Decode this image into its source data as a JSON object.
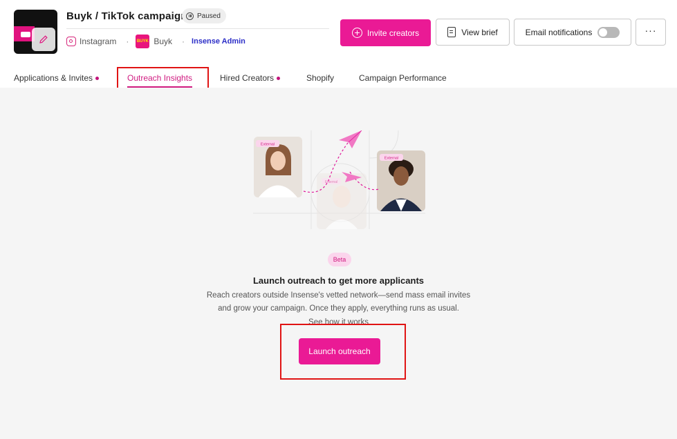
{
  "header": {
    "title": "Buyk / TikTok campaign",
    "status": "Paused",
    "platform": "Instagram",
    "brand": "Buyk",
    "brand_logo_text": "BUYK",
    "admin_label": "Insense Admin"
  },
  "actions": {
    "invite": "Invite creators",
    "brief": "View brief",
    "email": "Email notifications",
    "more": "···"
  },
  "tabs": [
    {
      "label": "Applications & Invites",
      "dot": true
    },
    {
      "label": "Outreach Insights",
      "active": true
    },
    {
      "label": "Hired Creators",
      "dot": true
    },
    {
      "label": "Shopify"
    },
    {
      "label": "Campaign Performance"
    }
  ],
  "illustration": {
    "tag_left": "External",
    "tag_right": "External",
    "tag_center": "External"
  },
  "main": {
    "badge": "Beta",
    "heading": "Launch outreach to get more applicants",
    "desc_line1": "Reach creators outside Insense's vetted network—send mass email invites",
    "desc_line2": "and grow your campaign. Once they apply, everything runs as usual.",
    "link": "See how it works",
    "cta": "Launch outreach"
  },
  "colors": {
    "accent": "#ea1a95",
    "highlight": "#e01313",
    "admin": "#2b2dc7",
    "background": "#f5f5f5"
  },
  "icons": [
    "pencil-icon",
    "pause-icon",
    "instagram-icon",
    "plus-circle-icon",
    "document-icon",
    "more-icon",
    "paper-plane-icon"
  ]
}
